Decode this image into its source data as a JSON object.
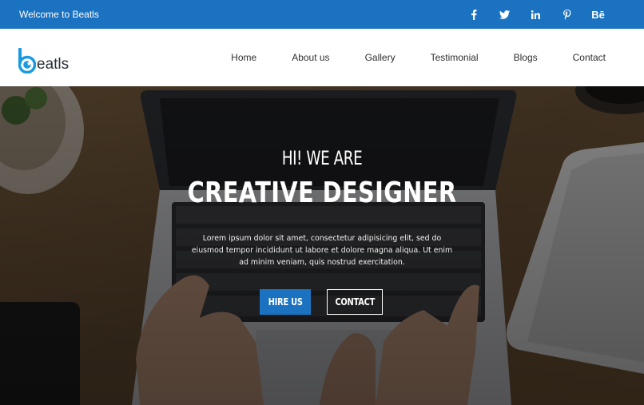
{
  "topbar": {
    "welcome": "Welcome to Beatls",
    "social": [
      {
        "icon": "facebook-icon"
      },
      {
        "icon": "twitter-icon"
      },
      {
        "icon": "linkedin-icon"
      },
      {
        "icon": "pinterest-icon"
      },
      {
        "icon": "behance-icon",
        "glyph": "Bē"
      }
    ]
  },
  "brand": {
    "name": "eatls",
    "mark": "b"
  },
  "nav": {
    "items": [
      "Home",
      "About us",
      "Gallery",
      "Testimonial",
      "Blogs",
      "Contact"
    ]
  },
  "hero": {
    "pre": "HI! WE ARE",
    "title": "CREATIVE DESIGNER",
    "description": "Lorem ipsum dolor sit amet, consectetur adipisicing elit, sed do eiusmod tempor incididunt ut labore et dolore magna aliqua. Ut enim ad minim veniam, quis nostrud exercitation.",
    "primary_button": "HIRE US",
    "secondary_button": "CONTACT"
  },
  "colors": {
    "primary": "#1b72c0",
    "text_dark": "#2f2f2f",
    "white": "#ffffff"
  }
}
